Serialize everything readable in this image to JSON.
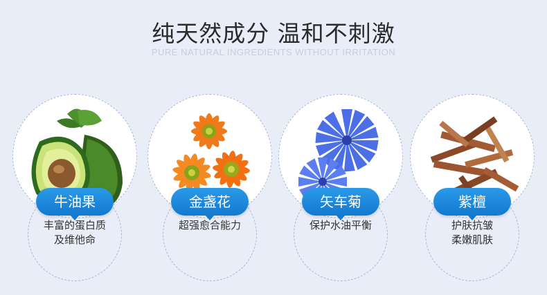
{
  "header": {
    "title": "纯天然成分 温和不刺激",
    "subtitle": "PURE NATURAL INGREDIENTS WITHOUT IRRITATION"
  },
  "ingredients": [
    {
      "name": "牛油果",
      "desc": "丰富的蛋白质\n及维他命",
      "image": "avocado-image"
    },
    {
      "name": "金盏花",
      "desc": "超强愈合能力",
      "image": "calendula-image"
    },
    {
      "name": "矢车菊",
      "desc": "保护水油平衡",
      "image": "cornflower-image"
    },
    {
      "name": "紫檀",
      "desc": "护肤抗皱\n柔嫩肌肤",
      "image": "sandalwood-image"
    }
  ],
  "colors": {
    "accent": "#1a86da",
    "background": "#e9edf8"
  }
}
